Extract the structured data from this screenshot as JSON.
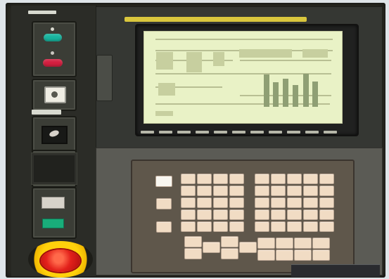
{
  "scene": {
    "subject": "cnc-control-panel",
    "colors": {
      "panel": "#2b2c27",
      "screen": "#e9f2c6",
      "keys": "#f1dcc4",
      "estop": "#e3211b",
      "estop-ring": "#ffd10c",
      "accent-strip": "#d9c63d"
    },
    "elements": {
      "display": "display-screen",
      "keypad": "keypad",
      "emergency_stop": "emergency-stop-button",
      "controls": "control-buttons"
    }
  }
}
